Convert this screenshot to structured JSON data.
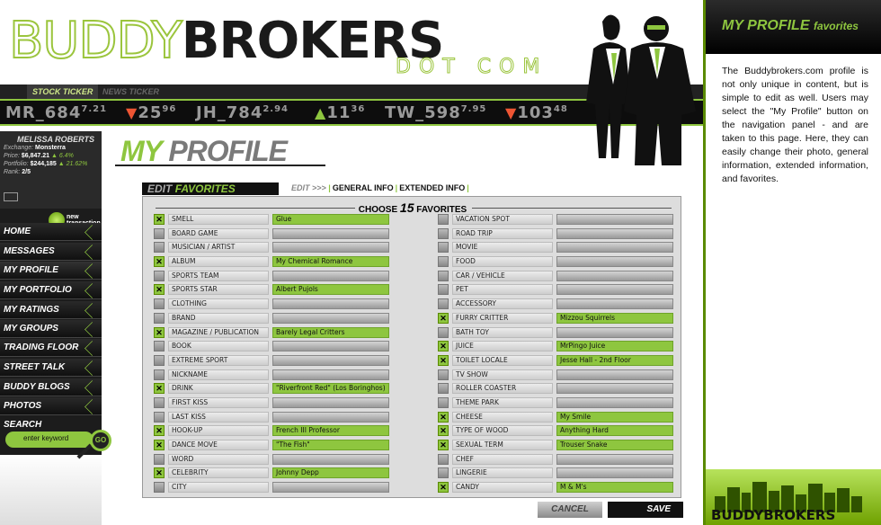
{
  "header": {
    "logo_buddy": "BUDDY",
    "logo_brokers": "BROKERS",
    "logo_dotcom": "DOT COM",
    "tabs": [
      "STOCK TICKER",
      "NEWS TICKER"
    ],
    "ticker": [
      {
        "symbol": "MR",
        "value": "684",
        "sup": "7.21"
      },
      {
        "dir": "down",
        "value": "25",
        "sup": "96"
      },
      {
        "symbol": "JH",
        "value": "784",
        "sup": "2.94"
      },
      {
        "dir": "up",
        "value": "11",
        "sup": "36"
      },
      {
        "symbol": "TW",
        "value": "598",
        "sup": "7.95"
      },
      {
        "dir": "down",
        "value": "103",
        "sup": "48"
      }
    ]
  },
  "user": {
    "name": "MELISSA ROBERTS",
    "exchange_label": "Exchange:",
    "exchange": "Monsterra",
    "price_label": "Price:",
    "price": "$6,847.21",
    "price_change": "6.4%",
    "portfolio_label": "Portfolio:",
    "portfolio": "$244,185",
    "portfolio_change": "21.62%",
    "rank_label": "Rank:",
    "rank": "2/5",
    "new_transaction": "new transaction"
  },
  "nav": [
    "HOME",
    "MESSAGES",
    "MY PROFILE",
    "MY PORTFOLIO",
    "MY RATINGS",
    "MY GROUPS",
    "TRADING FLOOR",
    "STREET TALK",
    "BUDDY BLOGS",
    "PHOTOS"
  ],
  "search": {
    "label": "SEARCH",
    "placeholder": "enter keyword",
    "go": "GO"
  },
  "page": {
    "title_my": "MY",
    "title_profile": "PROFILE"
  },
  "edit": {
    "heading_edit": "EDIT",
    "heading_fav": "FAVORITES",
    "subnav_edit": "EDIT >>>",
    "subnav": [
      "GENERAL INFO",
      "EXTENDED INFO"
    ],
    "choose_pre": "CHOOSE",
    "choose_num": "15",
    "choose_post": "FAVORITES"
  },
  "favorites_left": [
    {
      "label": "SMELL",
      "value": "Glue",
      "checked": true
    },
    {
      "label": "BOARD GAME",
      "value": "",
      "checked": false
    },
    {
      "label": "MUSICIAN / ARTIST",
      "value": "",
      "checked": false
    },
    {
      "label": "ALBUM",
      "value": "My Chemical Romance",
      "checked": true
    },
    {
      "label": "SPORTS TEAM",
      "value": "",
      "checked": false
    },
    {
      "label": "SPORTS STAR",
      "value": "Albert Pujols",
      "checked": true
    },
    {
      "label": "CLOTHING",
      "value": "",
      "checked": false
    },
    {
      "label": "BRAND",
      "value": "",
      "checked": false
    },
    {
      "label": "MAGAZINE / PUBLICATION",
      "value": "Barely Legal Critters",
      "checked": true
    },
    {
      "label": "BOOK",
      "value": "",
      "checked": false
    },
    {
      "label": "EXTREME SPORT",
      "value": "",
      "checked": false
    },
    {
      "label": "NICKNAME",
      "value": "",
      "checked": false
    },
    {
      "label": "DRINK",
      "value": "\"Riverfront Red\" (Los Boringhos)",
      "checked": true
    },
    {
      "label": "FIRST KISS",
      "value": "",
      "checked": false
    },
    {
      "label": "LAST KISS",
      "value": "",
      "checked": false
    },
    {
      "label": "HOOK-UP",
      "value": "French III Professor",
      "checked": true
    },
    {
      "label": "DANCE MOVE",
      "value": "\"The Fish\"",
      "checked": true
    },
    {
      "label": "WORD",
      "value": "",
      "checked": false
    },
    {
      "label": "CELEBRITY",
      "value": "Johnny Depp",
      "checked": true
    },
    {
      "label": "CITY",
      "value": "",
      "checked": false
    }
  ],
  "favorites_right": [
    {
      "label": "VACATION SPOT",
      "value": "",
      "checked": false
    },
    {
      "label": "ROAD TRIP",
      "value": "",
      "checked": false
    },
    {
      "label": "MOVIE",
      "value": "",
      "checked": false
    },
    {
      "label": "FOOD",
      "value": "",
      "checked": false
    },
    {
      "label": "CAR / VEHICLE",
      "value": "",
      "checked": false
    },
    {
      "label": "PET",
      "value": "",
      "checked": false
    },
    {
      "label": "ACCESSORY",
      "value": "",
      "checked": false
    },
    {
      "label": "FURRY CRITTER",
      "value": "Mizzou Squirrels",
      "checked": true
    },
    {
      "label": "BATH TOY",
      "value": "",
      "checked": false
    },
    {
      "label": "JUICE",
      "value": "MrPingo Juice",
      "checked": true
    },
    {
      "label": "TOILET LOCALE",
      "value": "Jesse Hall - 2nd Floor",
      "checked": true
    },
    {
      "label": "TV SHOW",
      "value": "",
      "checked": false
    },
    {
      "label": "ROLLER COASTER",
      "value": "",
      "checked": false
    },
    {
      "label": "THEME PARK",
      "value": "",
      "checked": false
    },
    {
      "label": "CHEESE",
      "value": "My Smile",
      "checked": true
    },
    {
      "label": "TYPE OF WOOD",
      "value": "Anything Hard",
      "checked": true
    },
    {
      "label": "SEXUAL TERM",
      "value": "Trouser Snake",
      "checked": true
    },
    {
      "label": "CHEF",
      "value": "",
      "checked": false
    },
    {
      "label": "LINGERIE",
      "value": "",
      "checked": false
    },
    {
      "label": "CANDY",
      "value": "M & M's",
      "checked": true
    }
  ],
  "buttons": {
    "cancel": "CANCEL",
    "save": "SAVE"
  },
  "right_panel": {
    "title": "MY PROFILE",
    "title_sub": "favorites",
    "text": "The Buddybrokers.com profile is not only unique in content, but is simple to edit as well. Users may select the \"My Profile\" button on the navigation panel - and are taken to this page. Here, they can easily change their photo, general information, extended information, and favorites.",
    "footer_logo": "BUDDYBROKERS"
  },
  "colors": {
    "accent": "#8ec63f",
    "dark": "#111111"
  }
}
